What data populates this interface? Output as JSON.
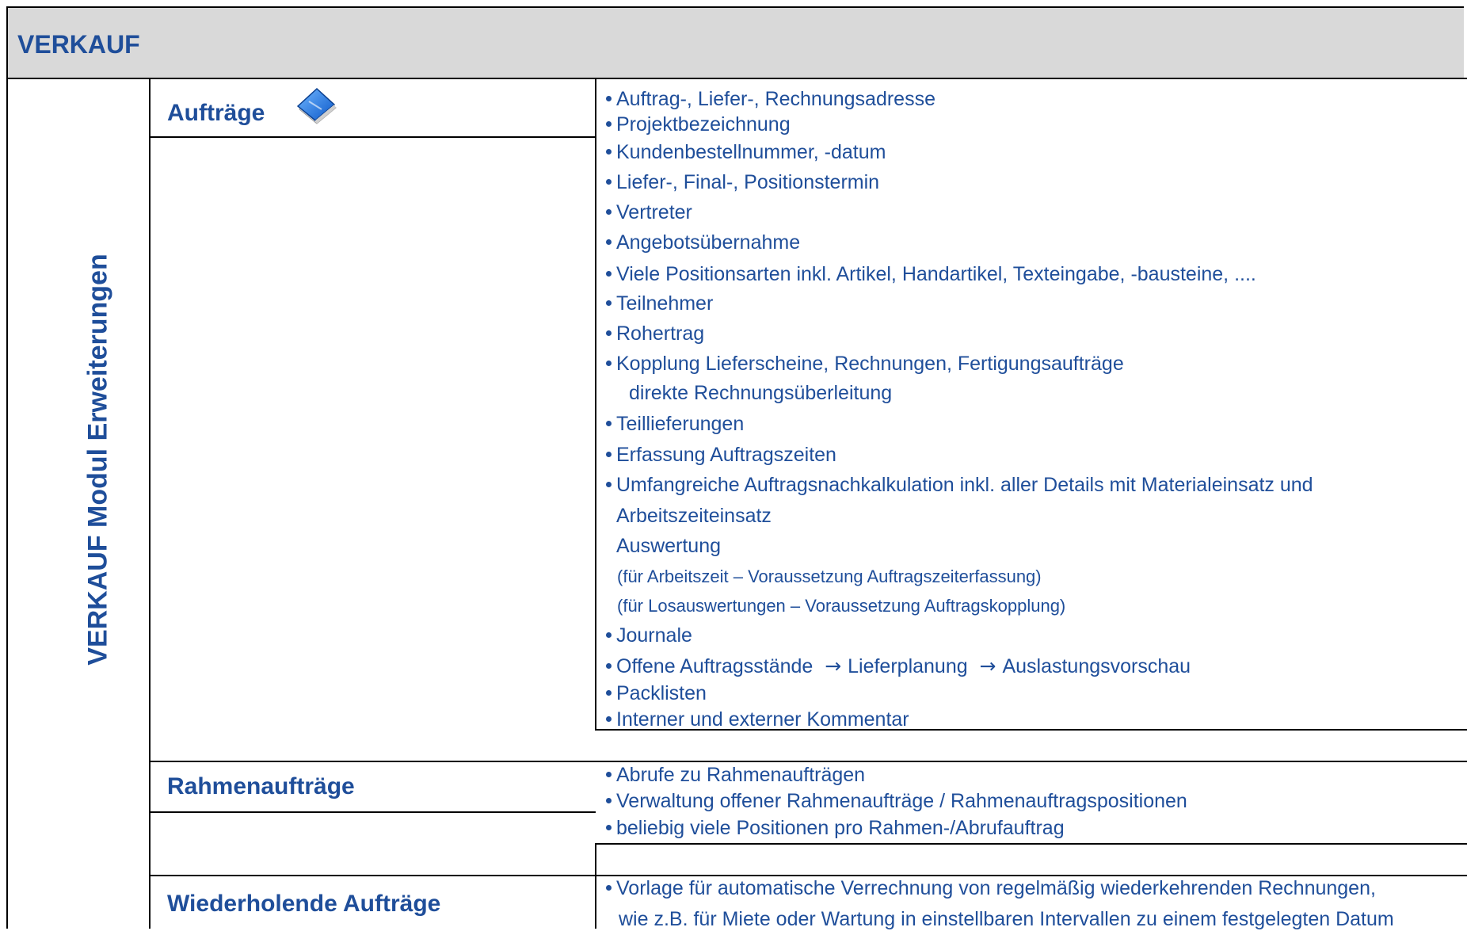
{
  "header": {
    "title": "VERKAUF"
  },
  "side_title": "VERKAUF Modul Erweiterungen",
  "sections": [
    {
      "title": "Aufträge",
      "icon": "book-icon",
      "items": [
        "Auftrag-, Liefer-, Rechnungsadresse",
        "Projektbezeichnung",
        "Kundenbestellnummer, -datum",
        "Liefer-, Final-, Positionstermin",
        "Vertreter",
        "Angebotsübernahme",
        "Viele Positionsarten inkl. Artikel, Handartikel, Texteingabe, -bausteine, ....",
        "Teilnehmer",
        "Rohertrag",
        "Kopplung Lieferscheine, Rechnungen, Fertigungsaufträge",
        "direkte Rechnungsüberleitung",
        "Teillieferungen",
        "Erfassung Auftragszeiten",
        "Umfangreiche Auftragsnachkalkulation inkl. aller Details mit Materialeinsatz und",
        "Arbeitszeiteinsatz",
        "Auswertung",
        "(für Arbeitszeit – Voraussetzung Auftragszeiterfassung)",
        "(für Losauswertungen – Voraussetzung Auftragskopplung)",
        "Journale",
        "Offene Auftragsstände",
        "Lieferplanung",
        "Auslastungsvorschau",
        "Packlisten",
        "Interner und externer Kommentar"
      ]
    },
    {
      "title": "Rahmenaufträge",
      "items": [
        "Abrufe zu Rahmenaufträgen",
        "Verwaltung offener Rahmenaufträge /  Rahmenauftragspositionen",
        "beliebig viele Positionen pro Rahmen-/Abrufauftrag"
      ]
    },
    {
      "title": "Wiederholende Aufträge",
      "items": [
        "Vorlage für automatische Verrechnung von regelmäßig wiederkehrenden Rechnungen,",
        "wie z.B. für Miete oder Wartung in einstellbaren Intervallen zu einem festgelegten Datum"
      ]
    }
  ],
  "colors": {
    "text": "#1f4e9a",
    "header_bg": "#d9d9d9",
    "lines": "#000000"
  }
}
